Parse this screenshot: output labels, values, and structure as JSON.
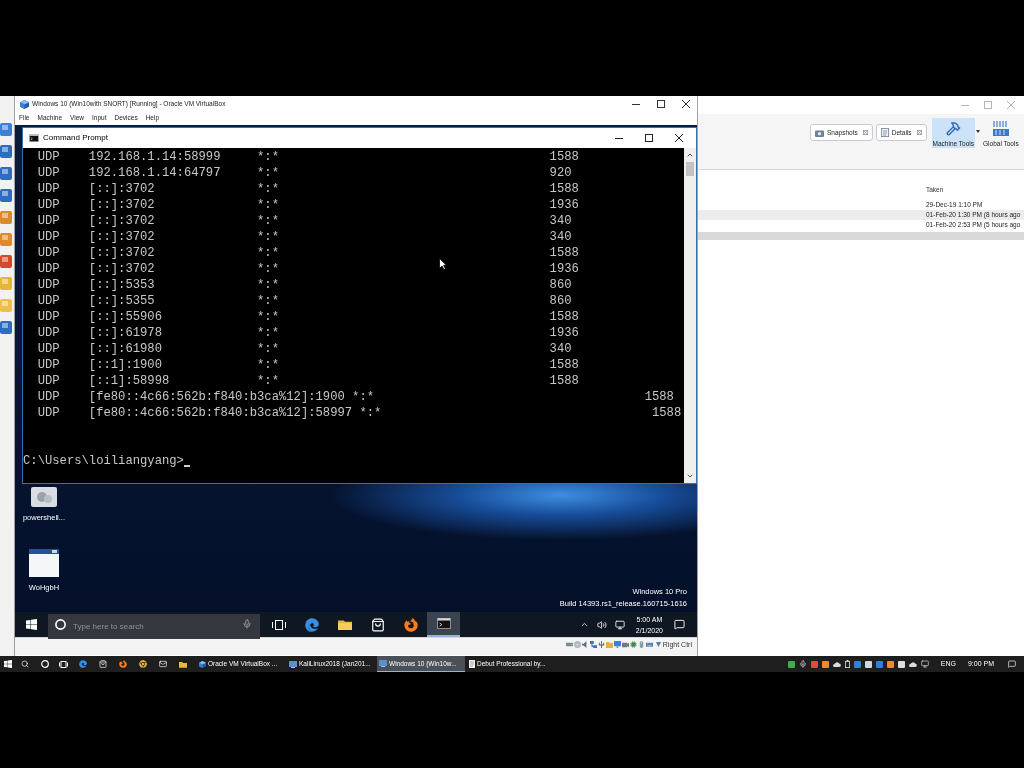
{
  "vbox_window": {
    "title": "Windows 10 (Win10with SNORT) [Running] - Oracle VM VirtualBox",
    "menu": [
      "File",
      "Machine",
      "View",
      "Input",
      "Devices",
      "Help"
    ],
    "host_key": "Right Ctrl"
  },
  "command_prompt": {
    "title": "Command Prompt",
    "connections": [
      {
        "proto": "UDP",
        "local": "192.168.1.14:58999",
        "foreign": "*:*",
        "pid": "1588"
      },
      {
        "proto": "UDP",
        "local": "192.168.1.14:64797",
        "foreign": "*:*",
        "pid": "920"
      },
      {
        "proto": "UDP",
        "local": "[::]:3702",
        "foreign": "*:*",
        "pid": "1588"
      },
      {
        "proto": "UDP",
        "local": "[::]:3702",
        "foreign": "*:*",
        "pid": "1936"
      },
      {
        "proto": "UDP",
        "local": "[::]:3702",
        "foreign": "*:*",
        "pid": "340"
      },
      {
        "proto": "UDP",
        "local": "[::]:3702",
        "foreign": "*:*",
        "pid": "340"
      },
      {
        "proto": "UDP",
        "local": "[::]:3702",
        "foreign": "*:*",
        "pid": "1588"
      },
      {
        "proto": "UDP",
        "local": "[::]:3702",
        "foreign": "*:*",
        "pid": "1936"
      },
      {
        "proto": "UDP",
        "local": "[::]:5353",
        "foreign": "*:*",
        "pid": "860"
      },
      {
        "proto": "UDP",
        "local": "[::]:5355",
        "foreign": "*:*",
        "pid": "860"
      },
      {
        "proto": "UDP",
        "local": "[::]:55906",
        "foreign": "*:*",
        "pid": "1588"
      },
      {
        "proto": "UDP",
        "local": "[::]:61978",
        "foreign": "*:*",
        "pid": "1936"
      },
      {
        "proto": "UDP",
        "local": "[::]:61980",
        "foreign": "*:*",
        "pid": "340"
      },
      {
        "proto": "UDP",
        "local": "[::1]:1900",
        "foreign": "*:*",
        "pid": "1588"
      },
      {
        "proto": "UDP",
        "local": "[::1]:58998",
        "foreign": "*:*",
        "pid": "1588"
      },
      {
        "proto": "UDP",
        "local": "[fe80::4c66:562b:f840:b3ca%12]:1900",
        "foreign": "*:*",
        "pid": "1588"
      },
      {
        "proto": "UDP",
        "local": "[fe80::4c66:562b:f840:b3ca%12]:58997",
        "foreign": "*:*",
        "pid": "1588"
      }
    ],
    "prompt": "C:\\Users\\loiliangyang>"
  },
  "guest_desktop": {
    "icons": [
      {
        "label": "powershell...",
        "kind": "script"
      },
      {
        "label": "WoHgbH",
        "kind": "window"
      }
    ],
    "edition": "Windows 10 Pro",
    "build": "Build 14393.rs1_release.160715-1616"
  },
  "guest_taskbar": {
    "search_placeholder": "Type here to search",
    "apps": [
      {
        "kind": "task-view",
        "selected": false
      },
      {
        "kind": "edge",
        "selected": false
      },
      {
        "kind": "explorer",
        "selected": false
      },
      {
        "kind": "store",
        "selected": false
      },
      {
        "kind": "firefox",
        "selected": false
      },
      {
        "kind": "terminal",
        "selected": true
      }
    ],
    "time": "5:00 AM",
    "date": "2/1/2020"
  },
  "manager_window": {
    "panes": [
      {
        "label": "Snapshots",
        "kind": "snapshots"
      },
      {
        "label": "Details",
        "kind": "details"
      }
    ],
    "tools": [
      {
        "label": "Machine Tools",
        "kind": "machine",
        "selected": true
      },
      {
        "label": "Global Tools",
        "kind": "global",
        "selected": false
      }
    ],
    "snapshots": {
      "column": "Taken",
      "rows": [
        {
          "taken": "29-Dec-19 1:10 PM",
          "selected": false
        },
        {
          "taken": "01-Feb-20 1:30 PM (8 hours ago",
          "selected": true
        },
        {
          "taken": "01-Feb-20 2:53 PM (5 hours ago",
          "selected": false
        }
      ]
    }
  },
  "host_taskbar": {
    "windows": [
      {
        "label": "Oracle VM VirtualBox ...",
        "kind": "virtualbox",
        "selected": false
      },
      {
        "label": "KaliLinux2018 (Jan201...",
        "kind": "vm",
        "selected": false
      },
      {
        "label": "Windows 10 (Win10w...",
        "kind": "vm",
        "selected": true
      },
      {
        "label": "Debut Professional by...",
        "kind": "recorder",
        "selected": false
      }
    ],
    "language": "ENG",
    "time": "9:00 PM"
  }
}
